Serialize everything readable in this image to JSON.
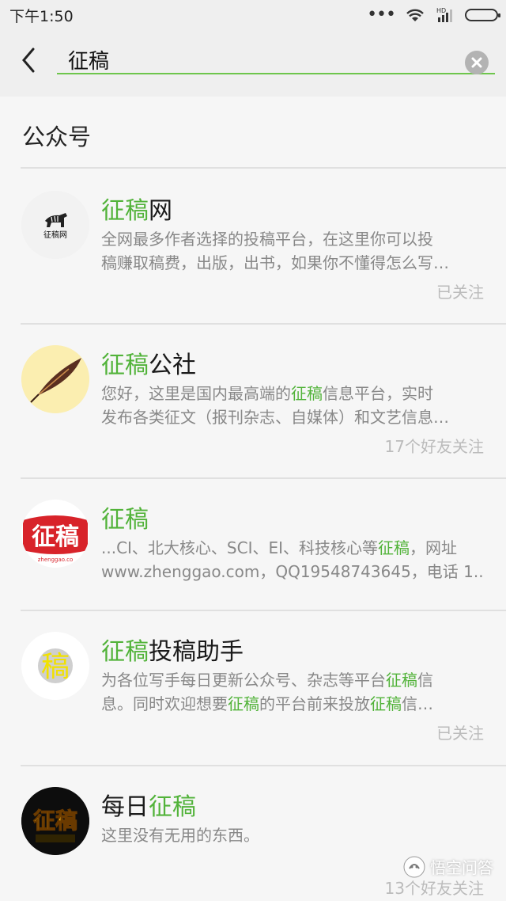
{
  "status_bar": {
    "time": "下午1:50",
    "network": "HD"
  },
  "search": {
    "query": "征稿"
  },
  "section_title": "公众号",
  "results": [
    {
      "title_parts": [
        "征稿",
        "网"
      ],
      "desc_lines": [
        "全网最多作者选择的投稿平台，在这里你可以投",
        "稿赚取稿费，出版，出书，如果你不懂得怎么写…"
      ],
      "follow": "已关注",
      "avatar_text": "征稿网"
    },
    {
      "title_parts": [
        "征稿",
        "公社"
      ],
      "desc_lines": [
        "您好，这里是国内最高端的征稿信息平台，实时",
        "发布各类征文（报刊杂志、自媒体）和文艺信息…"
      ],
      "follow": "17个好友关注"
    },
    {
      "title_parts": [
        "征稿",
        ""
      ],
      "desc_lines": [
        "...CI、北大核心、SCI、EI、科技核心等征稿，网址",
        "www.zhenggao.com，QQ19548743645，电话 1.."
      ],
      "follow": "",
      "avatar_text": "征稿",
      "avatar_sub": "zhenggao.co"
    },
    {
      "title_parts": [
        "征稿",
        "投稿助手"
      ],
      "desc_lines": [
        "为各位写手每日更新公众号、杂志等平台征稿信",
        "息。同时欢迎想要征稿的平台前来投放征稿信…"
      ],
      "follow": "已关注",
      "avatar_text": "稿"
    },
    {
      "title_parts": [
        "每日",
        "征稿"
      ],
      "desc_lines": [
        "这里没有无用的东西。"
      ],
      "follow": "13个好友关注",
      "avatar_text": "征稿"
    }
  ],
  "watermark": "悟空问答",
  "colors": {
    "accent": "#52b33a",
    "underline": "#6ec64c"
  }
}
